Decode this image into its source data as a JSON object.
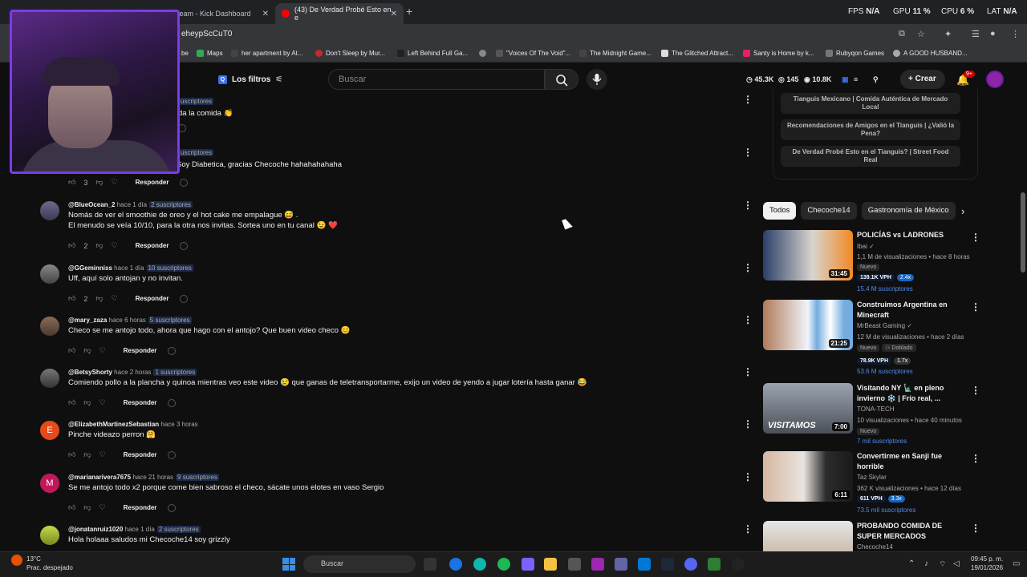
{
  "browser": {
    "tabs": [
      {
        "label": "",
        "active": false
      },
      {
        "label": "Stream - Kick Dashboard",
        "active": false
      },
      {
        "label": "(43) De Verdad Probé Esto en e",
        "active": true
      }
    ],
    "url": "eheypScCuT0",
    "perf": {
      "fps_label": "FPS",
      "fps_value": "N/A",
      "gpu_label": "GPU",
      "gpu_value": "11 %",
      "cpu_label": "CPU",
      "cpu_value": "6 %",
      "lat_label": "LAT",
      "lat_value": "N/A"
    },
    "bookmarks": [
      "be",
      "Maps",
      "her apartment by At...",
      "Don't Sleep by Mur...",
      "Left Behind Full Ga...",
      "\"Voices Of The Void\"...",
      "The Midnight Game...",
      "The Glitched Attract...",
      "Santy is Home by k...",
      "Rubyqon Games",
      "A GOOD HUSBAND..."
    ]
  },
  "youtube": {
    "filters_label": "Los filtros",
    "search_placeholder": "Buscar",
    "stats": {
      "views": "45.3K",
      "count1": "145",
      "count2": "10.8K"
    },
    "create_label": "Crear",
    "notif_badge": "9+"
  },
  "comments": [
    {
      "user": "",
      "time": "",
      "subs": "uscriptores",
      "text": "da la comida 👏",
      "likes": "",
      "partial": true
    },
    {
      "user": "",
      "time": "",
      "subs": "uscriptores",
      "text": "Soy Diabetica, gracias Checoche hahahahahaha",
      "likes": "3",
      "partial": true
    },
    {
      "user": "@BlueOcean_2",
      "time": "hace 1 día",
      "subs": "2 suscriptores",
      "text": "Nomás de ver el smoothie de oreo y el hot cake me empalague 😅 .",
      "text2": "El menudo se veía 10/10, para la otra nos invitas. Sortea uno en tu canal 😉 ❤️",
      "likes": "2"
    },
    {
      "user": "@GGeminniss",
      "time": "hace 1 día",
      "subs": "10 suscriptores",
      "text": "Uff, aquí solo antojan y no invitan.",
      "likes": "2"
    },
    {
      "user": "@mary_zaza",
      "time": "hace 6 horas",
      "subs": "5 suscriptores",
      "text": "Checo se me antojo todo, ahora que hago con el antojo? Que buen video checo 😊",
      "likes": ""
    },
    {
      "user": "@BetsyShorty",
      "time": "hace 2 horas",
      "subs": "1 suscriptores",
      "text": "Comiendo pollo a la plancha y quinoa mientras veo este video 😢 que ganas de teletransportarme, exijo un video de yendo a jugar lotería hasta ganar 😂",
      "likes": ""
    },
    {
      "user": "@ElizabethMartinezSebastian",
      "time": "hace 3 horas",
      "subs": "",
      "text": "Pinche videazo perron 🤗",
      "likes": ""
    },
    {
      "user": "@marianarivera7675",
      "time": "hace 21 horas",
      "subs": "9 suscriptores",
      "text": "Se me antojo todo x2 porque come bien sabroso el checo, sácate unos elotes en vaso Sergio",
      "likes": ""
    },
    {
      "user": "@jonatanruiz1020",
      "time": "hace 1 día",
      "subs": "2 suscriptores",
      "text": "Hola holaaa saludos mi Checoche14 soy grizzly",
      "likes": ""
    }
  ],
  "reply_label": "Responder",
  "playlist": [
    "Tianguis Mexicano | Comida Auténtica de Mercado Local",
    "Recomendaciones de Amigos en el Tianguis | ¿Valió la Pena?",
    "De Verdad Probé Esto en el Tianguis? | Street Food Real"
  ],
  "chips": [
    "Todos",
    "Checoche14",
    "Gastronomía de México"
  ],
  "videos": [
    {
      "title": "POLICÍAS vs LADRONES",
      "channel": "Ibai",
      "stats": "1,1 M de visualizaciones • hace 8 horas",
      "tag": "Nuevo",
      "vph": "139.1K VPH",
      "ratio": "2.4x",
      "subs": "15.4 M suscriptores",
      "duration": "31:45"
    },
    {
      "title": "Construimos Argentina en Minecraft",
      "channel": "MrBeast Gaming",
      "stats": "12 M de visualizaciones • hace 2 días",
      "tag": "Nuevo",
      "tag2": "Doblado",
      "vph": "78.9K VPH",
      "ratio": "1.7x",
      "subs": "53.6 M suscriptores",
      "duration": "21:25"
    },
    {
      "title": "Visitando NY 🗽 en pleno invierno ❄️ | Frío real, ...",
      "channel": "TONA-TECH",
      "stats": "10 visualizaciones • hace 40 minutos",
      "tag": "Nuevo",
      "subs": "7 mil suscriptores",
      "duration": "7:00"
    },
    {
      "title": "Convertirme en Sanji fue horrible",
      "channel": "Taz Skylar",
      "stats": "362 K visualizaciones • hace 12 días",
      "vph": "611 VPH",
      "ratio": "3.3x",
      "subs": "73.5 mil suscriptores",
      "duration": "6:11"
    },
    {
      "title": "PROBANDO COMIDA DE SUPER MERCADOS",
      "channel": "Checoche14"
    }
  ],
  "taskbar": {
    "temp": "13°C",
    "weather": "Prac. despejado",
    "search_label": "Buscar",
    "time": "09:45 p. m.",
    "date": "19/01/2026"
  }
}
